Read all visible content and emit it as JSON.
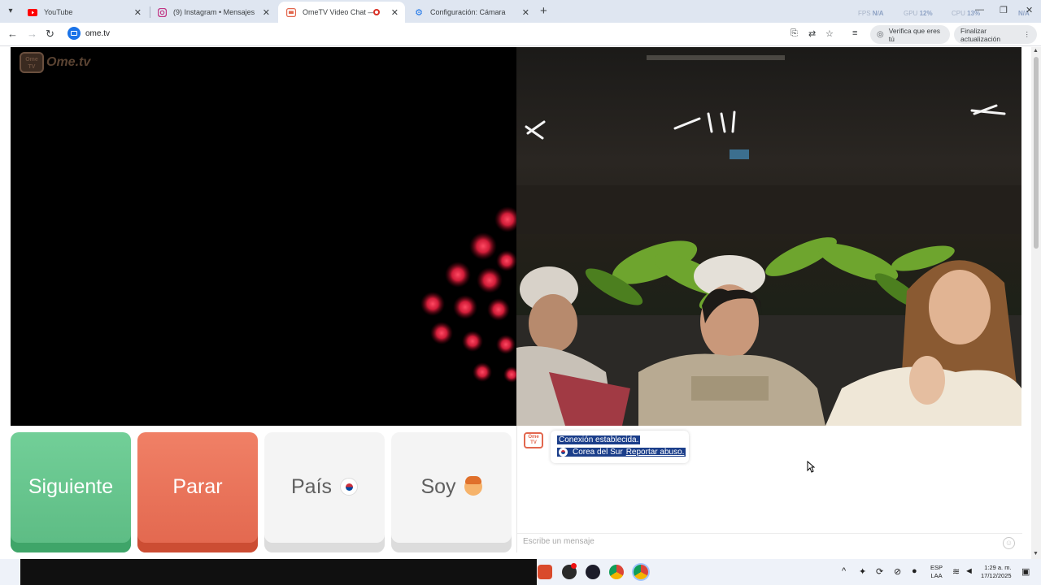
{
  "browser": {
    "tabs": [
      {
        "title": "YouTube",
        "favicon": "youtube-icon",
        "active": false
      },
      {
        "title": "(9) Instagram • Mensajes",
        "favicon": "instagram-icon",
        "active": false
      },
      {
        "title": "OmeTV Video Chat — Ome",
        "favicon": "ometv-icon",
        "active": true,
        "recording": true
      },
      {
        "title": "Configuración: Cámara",
        "favicon": "gear-icon",
        "active": false
      }
    ],
    "perf": {
      "fps_label": "FPS",
      "fps_value": "N/A",
      "gpu_label": "GPU",
      "gpu_value": "12%",
      "cpu_label": "CPU",
      "cpu_value": "13%",
      "extra_value": "N/A"
    },
    "address": "ome.tv",
    "verify_label": "Verifica que eres tú",
    "update_label": "Finalizar actualización"
  },
  "page": {
    "logo_text": "Ome.tv",
    "logo_badge": "Ome TV",
    "buttons": {
      "next": "Siguiente",
      "stop": "Parar",
      "country": "País",
      "gender": "Soy"
    },
    "chat": {
      "avatar_text": "Ome TV",
      "status": "Conexión establecida.",
      "country": "Corea del Sur",
      "report": "Reportar abuso.",
      "placeholder": "Escribe un mensaje"
    }
  },
  "taskbar": {
    "lang_line1": "ESP",
    "lang_line2": "LAA",
    "time": "1:29 a. m.",
    "date": "17/12/2025"
  },
  "colors": {
    "next_button": "#5cbb83",
    "stop_button": "#e2674e",
    "selection": "#1b3e8a"
  }
}
